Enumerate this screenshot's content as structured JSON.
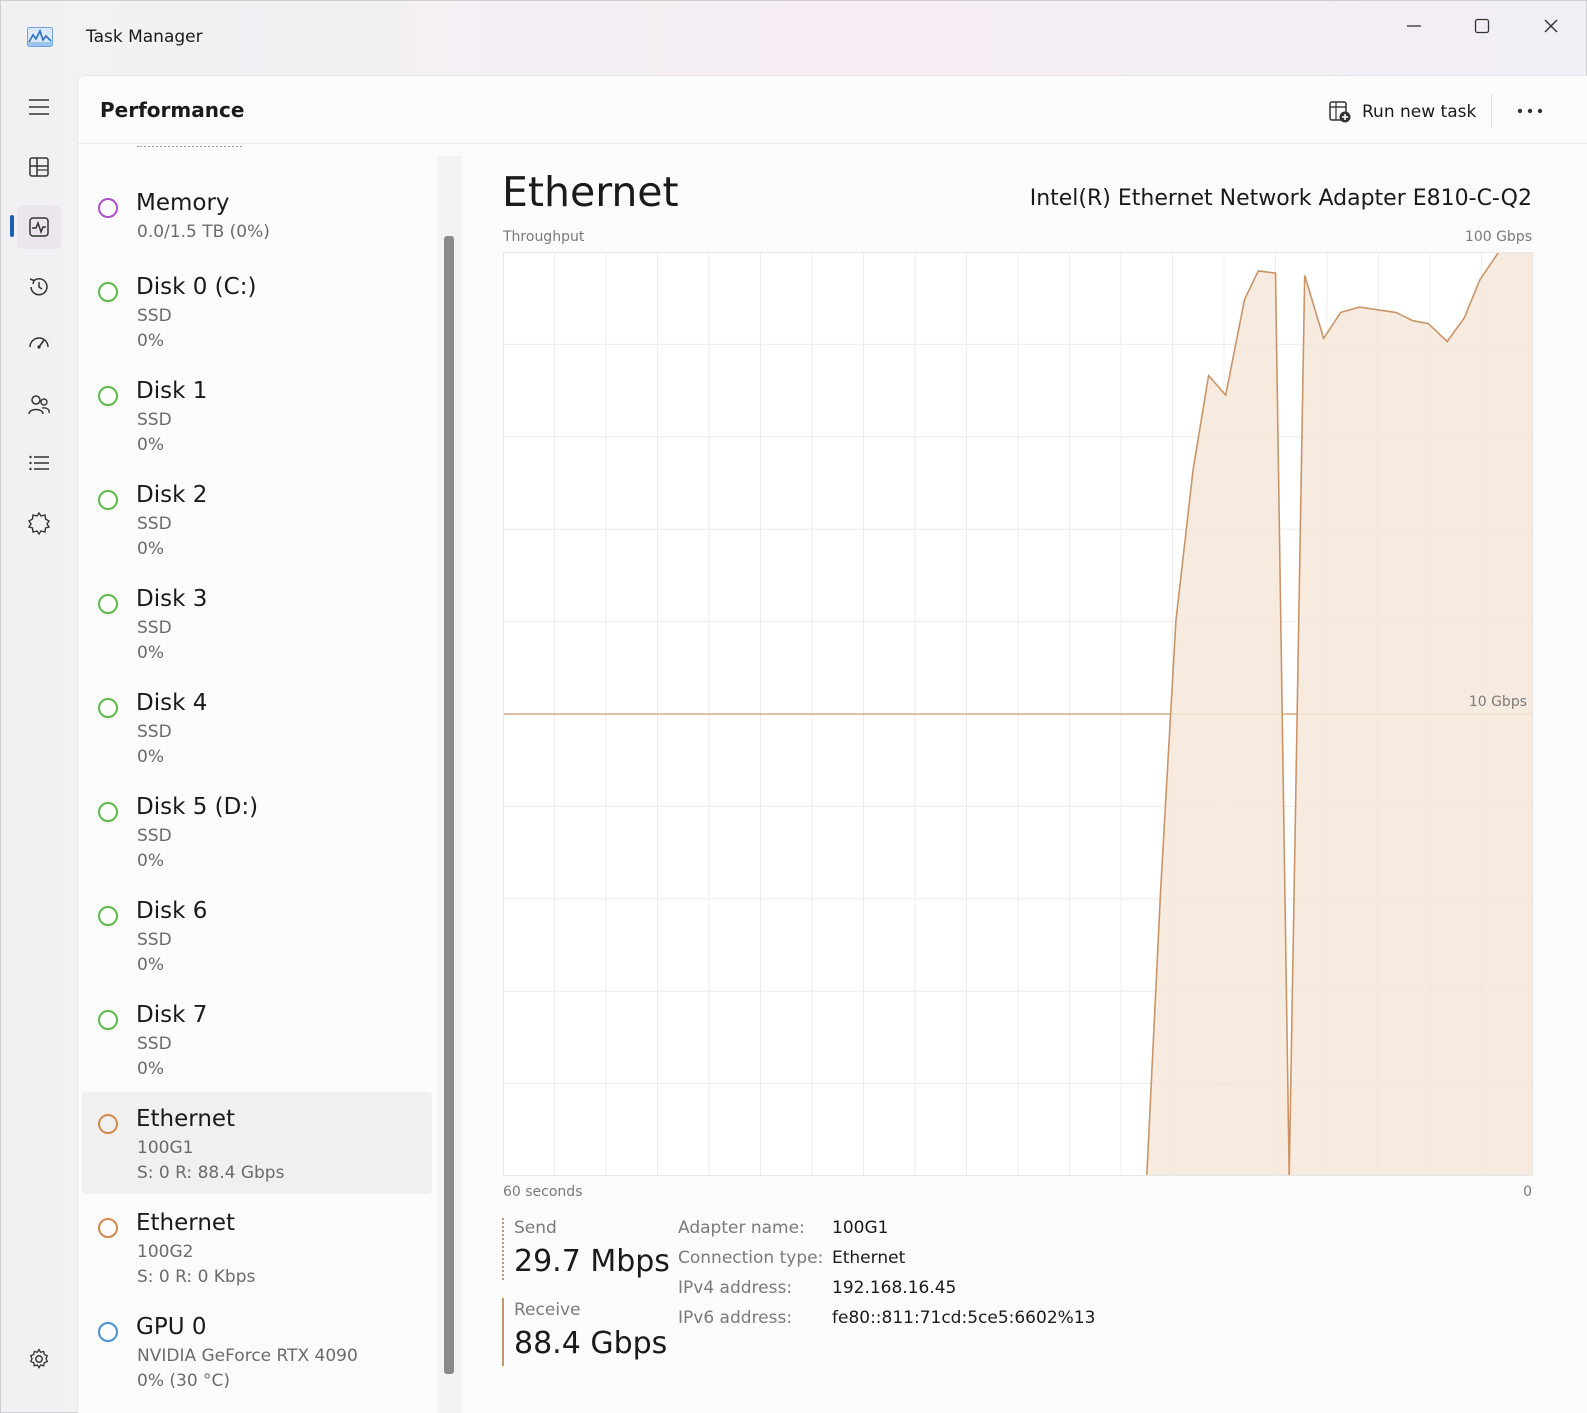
{
  "window": {
    "title": "Task Manager"
  },
  "header": {
    "title": "Performance",
    "run_new_task": "Run new task"
  },
  "rail": {
    "items": [
      "menu-icon",
      "processes-icon",
      "performance-icon",
      "app-history-icon",
      "startup-apps-icon",
      "users-icon",
      "details-icon",
      "services-icon",
      "settings-icon"
    ]
  },
  "devices": [
    {
      "name": "Memory",
      "sub1": "0.0/1.5 TB (0%)",
      "sub2": "",
      "color": "#b04fc7"
    },
    {
      "name": "Disk 0 (C:)",
      "sub1": "SSD",
      "sub2": "0%",
      "color": "#5fb84a"
    },
    {
      "name": "Disk 1",
      "sub1": "SSD",
      "sub2": "0%",
      "color": "#5fb84a"
    },
    {
      "name": "Disk 2",
      "sub1": "SSD",
      "sub2": "0%",
      "color": "#5fb84a"
    },
    {
      "name": "Disk 3",
      "sub1": "SSD",
      "sub2": "0%",
      "color": "#5fb84a"
    },
    {
      "name": "Disk 4",
      "sub1": "SSD",
      "sub2": "0%",
      "color": "#5fb84a"
    },
    {
      "name": "Disk 5 (D:)",
      "sub1": "SSD",
      "sub2": "0%",
      "color": "#5fb84a"
    },
    {
      "name": "Disk 6",
      "sub1": "SSD",
      "sub2": "0%",
      "color": "#5fb84a"
    },
    {
      "name": "Disk 7",
      "sub1": "SSD",
      "sub2": "0%",
      "color": "#5fb84a"
    },
    {
      "name": "Ethernet",
      "sub1": "100G1",
      "sub2": "S: 0 R: 88.4 Gbps",
      "color": "#d08a4a",
      "selected": true
    },
    {
      "name": "Ethernet",
      "sub1": "100G2",
      "sub2": "S: 0 R: 0 Kbps",
      "color": "#d08a4a"
    },
    {
      "name": "GPU 0",
      "sub1": "NVIDIA GeForce RTX 4090",
      "sub2": "0% (30 °C)",
      "color": "#4a90d0"
    }
  ],
  "detail": {
    "title": "Ethernet",
    "adapter": "Intel(R) Ethernet Network Adapter E810-C-Q2",
    "send_label": "Send",
    "send_value": "29.7 Mbps",
    "receive_label": "Receive",
    "receive_value": "88.4 Gbps",
    "props": [
      {
        "key": "Adapter name:",
        "value": "100G1"
      },
      {
        "key": "Connection type:",
        "value": "Ethernet"
      },
      {
        "key": "IPv4 address:",
        "value": "192.168.16.45"
      },
      {
        "key": "IPv6 address:",
        "value": "fe80::811:71cd:5ce5:6602%13"
      }
    ]
  },
  "chart_data": {
    "type": "area",
    "title": "Throughput",
    "y_max_label": "100 Gbps",
    "y_marker_label": "10 Gbps",
    "x_start_label": "60 seconds",
    "x_end_label": "0",
    "x_unit": "seconds ago",
    "y_unit": "Gbps",
    "scale": "log",
    "ylim": [
      1,
      100
    ],
    "xlim": [
      60,
      0
    ],
    "grid": true,
    "series": [
      {
        "name": "Receive",
        "color": "#c8956a",
        "x": [
          60,
          22.5,
          21.7,
          20.8,
          19.8,
          18.9,
          17.9,
          16.8,
          16.0,
          15.0,
          14.2,
          13.3,
          12.2,
          11.2,
          10.1,
          9.1,
          8.0,
          7.0,
          6.1,
          5.0,
          4.0,
          3.1,
          2.0,
          1.1,
          0
        ],
        "y": [
          1,
          1,
          4.1,
          15.9,
          33.8,
          54.0,
          49.0,
          79.0,
          91.0,
          90.0,
          1,
          89.0,
          65.0,
          74.0,
          76.0,
          75.0,
          74.0,
          71.0,
          70.0,
          64.0,
          72.0,
          87.0,
          100,
          100,
          100
        ]
      }
    ]
  }
}
